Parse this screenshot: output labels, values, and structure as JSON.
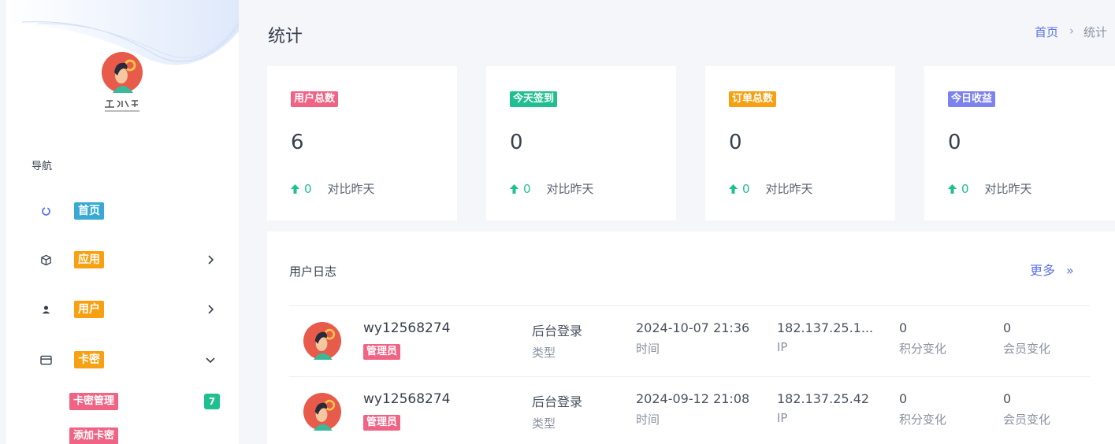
{
  "sidebar": {
    "nav_title": "导航",
    "items": [
      {
        "label": "首页",
        "color": "#37a9d2",
        "icon": "spinner-icon"
      },
      {
        "label": "应用",
        "color": "#f7a011",
        "icon": "cube-icon"
      },
      {
        "label": "用户",
        "color": "#f7a011",
        "icon": "user-icon"
      },
      {
        "label": "卡密",
        "color": "#f7a011",
        "icon": "card-icon"
      }
    ],
    "sub_items": [
      {
        "label": "卡密管理",
        "count": "7"
      },
      {
        "label": "添加卡密"
      }
    ]
  },
  "header": {
    "title": "统计",
    "breadcrumb_home": "首页",
    "breadcrumb_sep": "›",
    "breadcrumb_current": "统计"
  },
  "stats": [
    {
      "tag": "用户总数",
      "color": "#f06384",
      "value": "6",
      "delta": "0",
      "compare": "对比昨天"
    },
    {
      "tag": "今天签到",
      "color": "#1fbf8f",
      "value": "0",
      "delta": "0",
      "compare": "对比昨天"
    },
    {
      "tag": "订单总数",
      "color": "#f7a011",
      "value": "0",
      "delta": "0",
      "compare": "对比昨天"
    },
    {
      "tag": "今日收益",
      "color": "#7c83f0",
      "value": "0",
      "delta": "0",
      "compare": "对比昨天"
    }
  ],
  "log": {
    "title": "用户日志",
    "more": "更多",
    "more_arrow": "»",
    "rows": [
      {
        "user": "wy12568274",
        "role": "管理员",
        "type": "后台登录",
        "type_label": "类型",
        "time": "2024-10-07 21:36",
        "time_label": "时间",
        "ip": "182.137.25.1...",
        "ip_label": "IP",
        "points": "0",
        "points_label": "积分变化",
        "member": "0",
        "member_label": "会员变化"
      },
      {
        "user": "wy12568274",
        "role": "管理员",
        "type": "后台登录",
        "type_label": "类型",
        "time": "2024-09-12 21:08",
        "time_label": "时间",
        "ip": "182.137.25.42",
        "ip_label": "IP",
        "points": "0",
        "points_label": "积分变化",
        "member": "0",
        "member_label": "会员变化"
      }
    ]
  }
}
